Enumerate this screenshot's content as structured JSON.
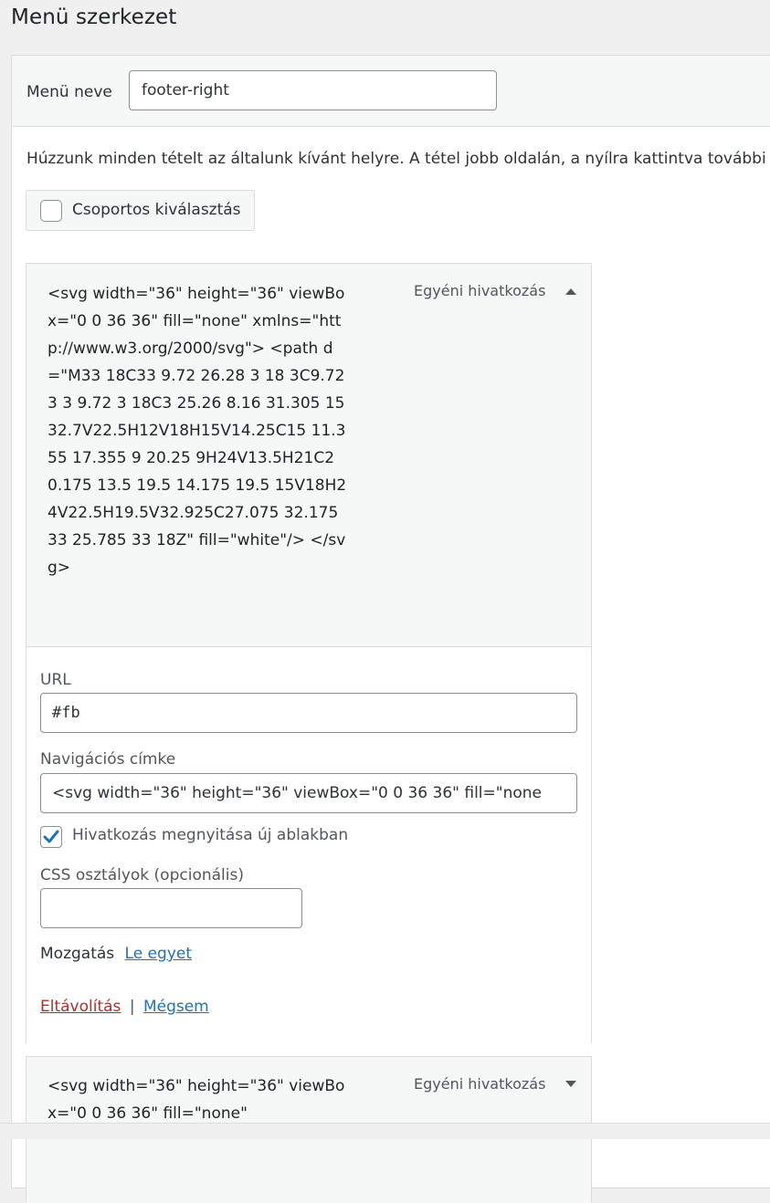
{
  "page": {
    "title": "Menü szerkezet"
  },
  "menu_name": {
    "label": "Menü neve",
    "value": "footer-right"
  },
  "instructions": "Húzzunk minden tételt az általunk kívánt helyre. A tétel jobb oldalán, a nyílra kattintva további l",
  "bulk_select": {
    "label": "Csoportos kiválasztás",
    "checked": false
  },
  "items": [
    {
      "title": "<svg width=\"36\" height=\"36\" viewBox=\"0 0 36 36\" fill=\"none\" xmlns=\"http://www.w3.org/2000/svg\"> <path d=\"M33 18C33 9.72 26.28 3 18 3C9.72 3 3 9.72 3 18C3 25.26 8.16 31.305 15 32.7V22.5H12V18H15V14.25C15 11.355 17.355 9 20.25 9H24V13.5H21C20.175 13.5 19.5 14.175 19.5 15V18H24V22.5H19.5V32.925C27.075 32.175 33 25.785 33 18Z\" fill=\"white\"/> </svg>",
      "type": "Egyéni hivatkozás",
      "expanded": true,
      "url_label": "URL",
      "url_value": "#fb",
      "nav_label": "Navigációs címke",
      "nav_value": "<svg width=\"36\" height=\"36\" viewBox=\"0 0 36 36\" fill=\"none",
      "new_window_label": "Hivatkozás megnyitása új ablakban",
      "new_window_checked": true,
      "css_label": "CSS osztályok (opcionális)",
      "css_value": "",
      "move_label": "Mozgatás",
      "move_link": "Le egyet",
      "remove_label": "Eltávolítás",
      "separator": "|",
      "cancel_label": "Mégsem"
    },
    {
      "title": "<svg width=\"36\" height=\"36\" viewBox=\"0 0 36 36\" fill=\"none\"",
      "type": "Egyéni hivatkozás",
      "expanded": false
    }
  ]
}
